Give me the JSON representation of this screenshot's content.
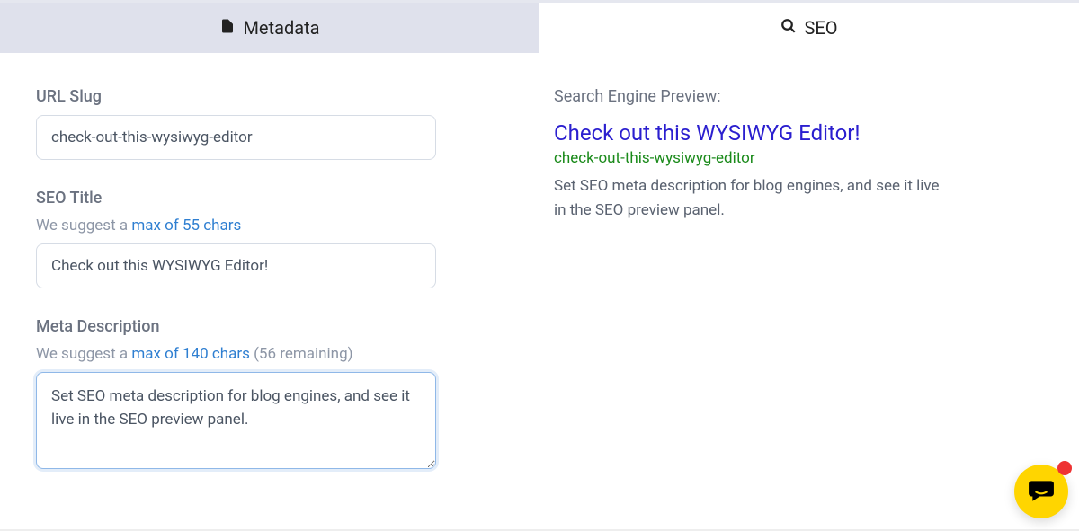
{
  "tabs": {
    "metadata": "Metadata",
    "seo": "SEO"
  },
  "fields": {
    "slug": {
      "label": "URL Slug",
      "value": "check-out-this-wysiwyg-editor"
    },
    "title": {
      "label": "SEO Title",
      "hintPrefix": "We suggest a ",
      "hintLink": "max of 55 chars",
      "value": "Check out this WYSIWYG Editor!"
    },
    "meta": {
      "label": "Meta Description",
      "hintPrefix": "We suggest a ",
      "hintLink": "max of 140 chars",
      "hintSuffix": " (56 remaining)",
      "value": "Set SEO meta description for blog engines, and see it live in the SEO preview panel."
    }
  },
  "preview": {
    "label": "Search Engine Preview:",
    "title": "Check out this WYSIWYG Editor!",
    "url": "check-out-this-wysiwyg-editor",
    "desc": "Set SEO meta description for blog engines, and see it live in the SEO preview panel."
  }
}
